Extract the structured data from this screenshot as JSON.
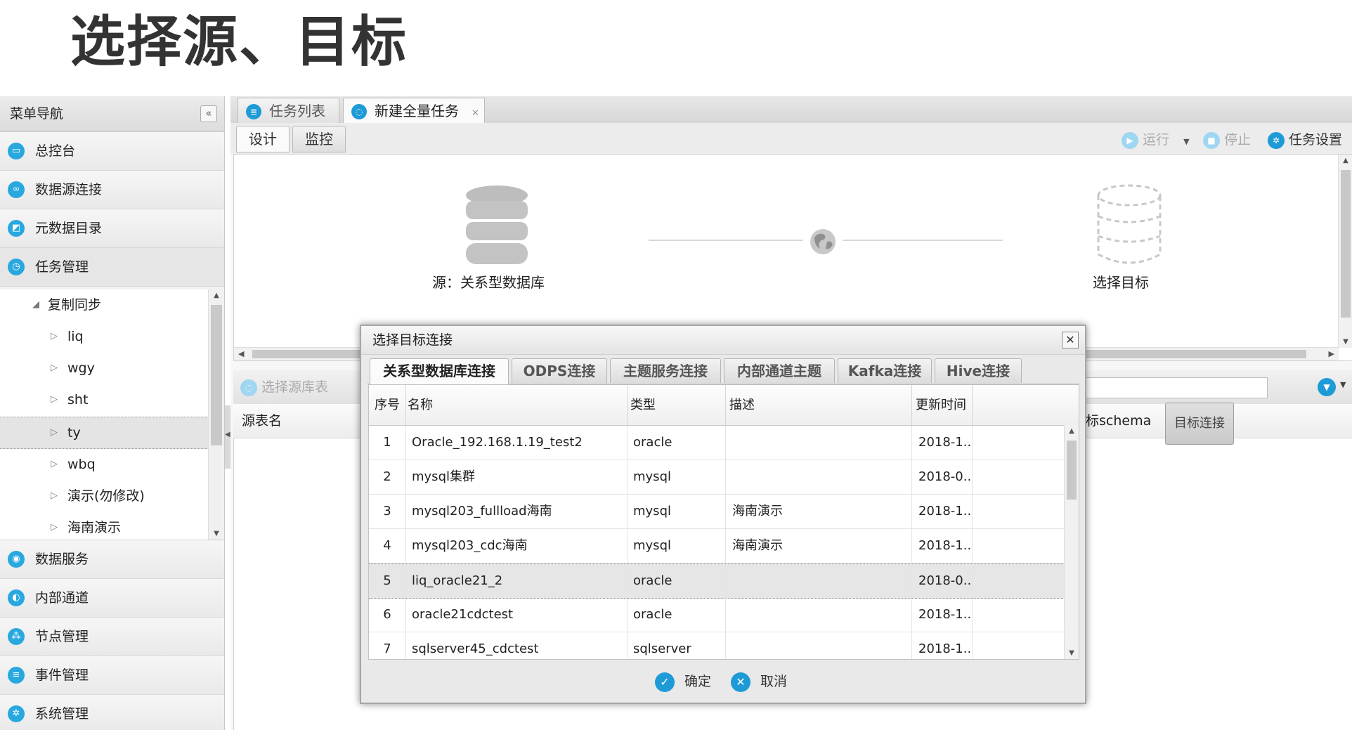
{
  "page_title": "选择源、目标",
  "sidebar": {
    "title": "菜单导航",
    "collapse_icon": "«",
    "top_items": [
      {
        "label": "总控台",
        "icon": "monitor-icon"
      },
      {
        "label": "数据源连接",
        "icon": "link-icon"
      },
      {
        "label": "元数据目录",
        "icon": "chart-icon"
      },
      {
        "label": "任务管理",
        "icon": "clock-icon"
      }
    ],
    "tree": {
      "root": "复制同步",
      "children": [
        "liq",
        "wgy",
        "sht",
        "ty",
        "wbq",
        "演示(勿修改)",
        "海南演示"
      ],
      "selected": "ty"
    },
    "bottom_items": [
      {
        "label": "数据服务",
        "icon": "service-icon"
      },
      {
        "label": "内部通道",
        "icon": "channel-icon"
      },
      {
        "label": "节点管理",
        "icon": "nodes-icon"
      },
      {
        "label": "事件管理",
        "icon": "event-icon"
      },
      {
        "label": "系统管理",
        "icon": "gear-icon"
      }
    ]
  },
  "tabs": [
    {
      "label": "任务列表",
      "icon": "list-icon"
    },
    {
      "label": "新建全量任务",
      "icon": "task-icon"
    }
  ],
  "subtabs": [
    "设计",
    "监控"
  ],
  "toolbar": {
    "run": "运行",
    "stop": "停止",
    "settings": "任务设置"
  },
  "canvas": {
    "source_label": "源：关系型数据库",
    "target_label": "选择目标",
    "target_button": "目标连接"
  },
  "lower": {
    "select_source_table": "选择源库表",
    "col_source_table": "源表名",
    "col_target_schema": "目标schema"
  },
  "dialog": {
    "title": "选择目标连接",
    "tabs": [
      "关系型数据库连接",
      "ODPS连接",
      "主题服务连接",
      "内部通道主题",
      "Kafka连接",
      "Hive连接"
    ],
    "columns": [
      "序号",
      "名称",
      "类型",
      "描述",
      "更新时间"
    ],
    "rows": [
      [
        "1",
        "Oracle_192.168.1.19_test2",
        "oracle",
        "",
        "2018-1..."
      ],
      [
        "2",
        "mysql集群",
        "mysql",
        "",
        "2018-0..."
      ],
      [
        "3",
        "mysql203_fullload海南",
        "mysql",
        "海南演示",
        "2018-1..."
      ],
      [
        "4",
        "mysql203_cdc海南",
        "mysql",
        "海南演示",
        "2018-1..."
      ],
      [
        "5",
        "liq_oracle21_2",
        "oracle",
        "",
        "2018-0..."
      ],
      [
        "6",
        "oracle21cdctest",
        "oracle",
        "",
        "2018-1..."
      ],
      [
        "7",
        "sqlserver45_cdctest",
        "sqlserver",
        "",
        "2018-1..."
      ]
    ],
    "selected_row": 5,
    "ok": "确定",
    "cancel": "取消"
  },
  "colors": {
    "accent": "#1e9bd7",
    "sidebar_bg": "#f2f2f2",
    "dialog_bg": "#e9e9e9"
  }
}
